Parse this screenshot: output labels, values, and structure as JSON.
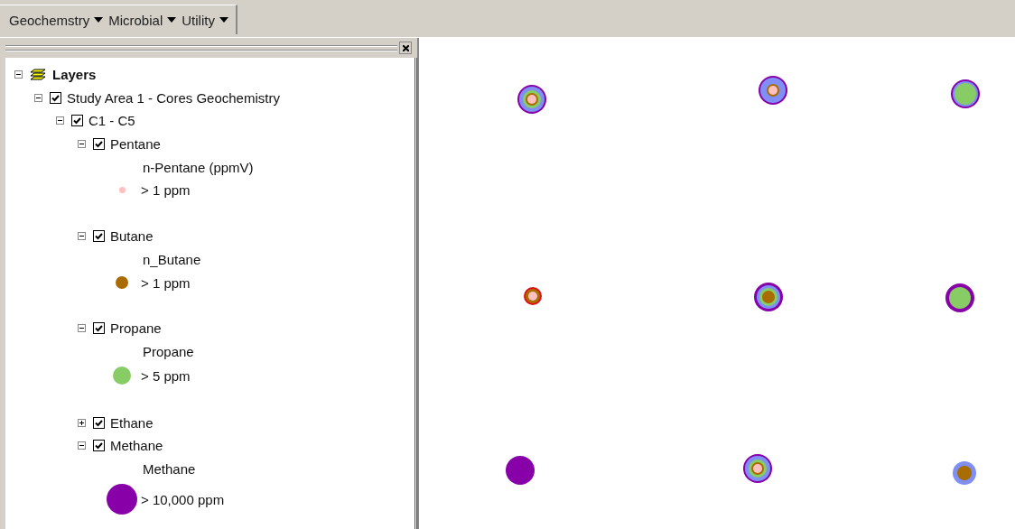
{
  "menu_bar": [
    {
      "label": "Geochemstry"
    },
    {
      "label": "Microbial"
    },
    {
      "label": "Utility"
    }
  ],
  "toc": {
    "root": {
      "label": "Layers",
      "expanded": true,
      "children": [
        {
          "label": "Study Area 1 - Cores Geochemistry",
          "checked": true,
          "expanded": true,
          "children": [
            {
              "label": "C1 - C5",
              "checked": true,
              "expanded": true,
              "layers": [
                {
                  "label": "Pentane",
                  "checked": true,
                  "expanded": true,
                  "field": "n-Pentane (ppmV)",
                  "legend": {
                    "label": "> 1 ppm",
                    "color": "#ffc0c0"
                  }
                },
                {
                  "label": "Butane",
                  "checked": true,
                  "expanded": true,
                  "field": "n_Butane",
                  "legend": {
                    "label": "> 1 ppm",
                    "color": "#a86c00"
                  }
                },
                {
                  "label": "Propane",
                  "checked": true,
                  "expanded": true,
                  "field": "Propane",
                  "legend": {
                    "label": "> 5 ppm",
                    "color": "#88cc66"
                  }
                },
                {
                  "label": "Ethane",
                  "checked": true,
                  "expanded": false
                },
                {
                  "label": "Methane",
                  "checked": true,
                  "expanded": true,
                  "field": "Methane",
                  "legend": {
                    "label": "> 10,000 ppm",
                    "color": "#8800a8"
                  }
                }
              ]
            }
          ]
        }
      ]
    }
  }
}
